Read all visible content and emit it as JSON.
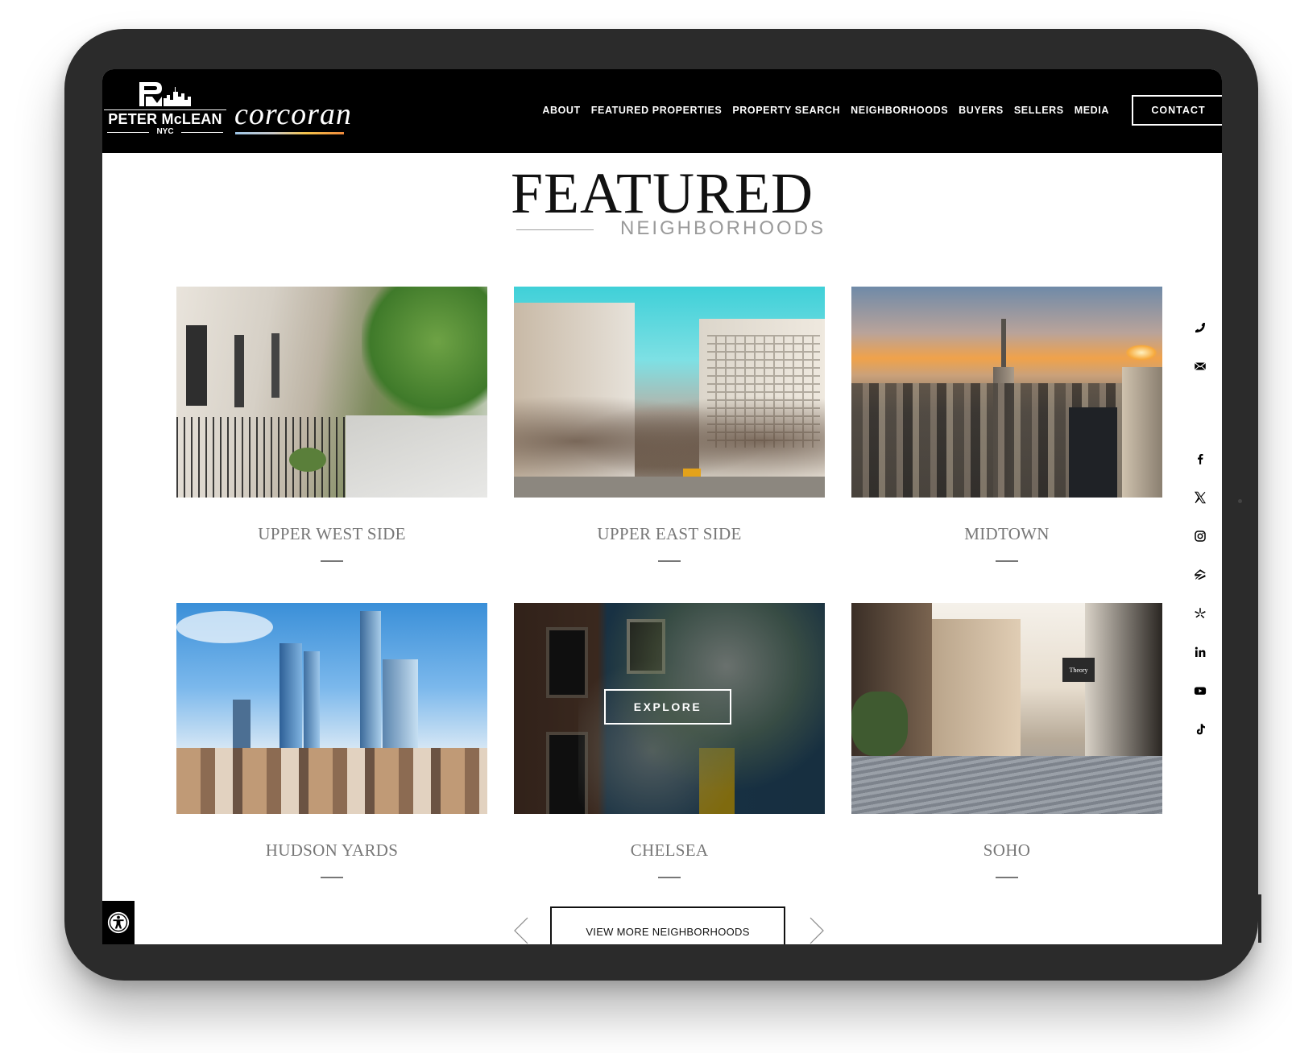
{
  "header": {
    "logo_name": "PETER McLEAN",
    "logo_sub": "NYC",
    "brand_partner": "corcoran",
    "nav": [
      "ABOUT",
      "FEATURED PROPERTIES",
      "PROPERTY SEARCH",
      "NEIGHBORHOODS",
      "BUYERS",
      "SELLERS",
      "MEDIA"
    ],
    "contact_label": "CONTACT"
  },
  "section": {
    "title": "FEATURED",
    "subtitle": "NEIGHBORHOODS"
  },
  "neighborhoods": [
    {
      "name": "UPPER WEST SIDE",
      "photo": "brownstone-street"
    },
    {
      "name": "UPPER EAST SIDE",
      "photo": "avenue-with-trees"
    },
    {
      "name": "MIDTOWN",
      "photo": "skyline-sunset"
    },
    {
      "name": "HUDSON YARDS",
      "photo": "glass-towers"
    },
    {
      "name": "CHELSEA",
      "photo": "blossom-townhouses",
      "hover_label": "EXPLORE"
    },
    {
      "name": "SOHO",
      "photo": "cobblestone-street",
      "sign_text": "Theory"
    }
  ],
  "social": [
    "phone-icon",
    "mail-icon",
    "facebook-icon",
    "x-icon",
    "instagram-icon",
    "zillow-icon",
    "yelp-icon",
    "linkedin-icon",
    "youtube-icon",
    "tiktok-icon"
  ],
  "footer": {
    "view_more_label": "VIEW MORE NEIGHBORHOODS"
  },
  "colors": {
    "header_bg": "#000000",
    "device_frame": "#2b2b2b",
    "caption_gray": "#777777"
  }
}
